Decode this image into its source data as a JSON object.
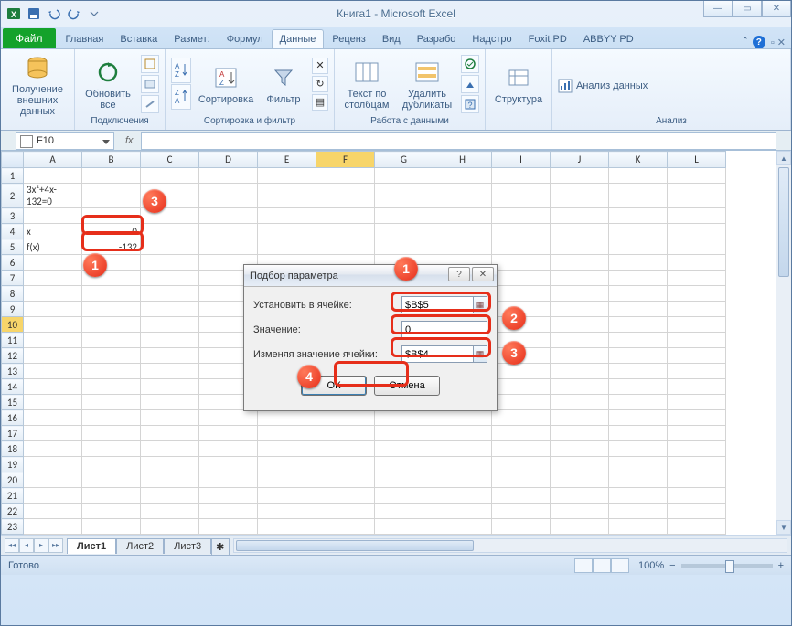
{
  "window": {
    "title": "Книга1 - Microsoft Excel",
    "file_tab": "Файл",
    "tabs": [
      "Главная",
      "Вставка",
      "Размет:",
      "Формул",
      "Данные",
      "Реценз",
      "Вид",
      "Разрабо",
      "Надстро",
      "Foxit PD",
      "ABBYY PD"
    ],
    "active_tab_index": 4
  },
  "ribbon": {
    "group_external": {
      "btn": "Получение внешних данных",
      "label": ""
    },
    "group_connections": {
      "refresh": "Обновить все",
      "label": "Подключения"
    },
    "group_sort": {
      "sort": "Сортировка",
      "filter": "Фильтр",
      "label": "Сортировка и фильтр"
    },
    "group_datatools": {
      "text_cols": "Текст по столбцам",
      "dedup": "Удалить дубликаты",
      "label": "Работа с данными"
    },
    "group_outline": {
      "btn": "Структура",
      "label": ""
    },
    "group_analysis": {
      "btn": "Анализ данных",
      "label": "Анализ"
    }
  },
  "namebox": "F10",
  "formula_bar": "",
  "columns": [
    "A",
    "B",
    "C",
    "D",
    "E",
    "F",
    "G",
    "H",
    "I",
    "J",
    "K",
    "L"
  ],
  "rows_shown": 23,
  "selected_row": 10,
  "selected_col": "F",
  "cells": {
    "A2": "3x²+4x-132=0",
    "A4": "x",
    "B4": "0",
    "A5": "f(x)",
    "B5": "-132"
  },
  "sheet_tabs": [
    "Лист1",
    "Лист2",
    "Лист3"
  ],
  "active_sheet": 0,
  "statusbar": {
    "ready": "Готово",
    "zoom": "100%"
  },
  "dialog": {
    "title": "Подбор параметра",
    "label_setcell": "Установить в ячейке:",
    "val_setcell": "$B$5",
    "label_value": "Значение:",
    "val_value": "0",
    "label_changing": "Изменяя значение ячейки:",
    "val_changing": "$B$4",
    "ok": "ОК",
    "cancel": "Отмена"
  },
  "markers": {
    "m1": "1",
    "m2": "2",
    "m3": "3",
    "m4": "4",
    "cell1": "1",
    "cell3": "3"
  }
}
